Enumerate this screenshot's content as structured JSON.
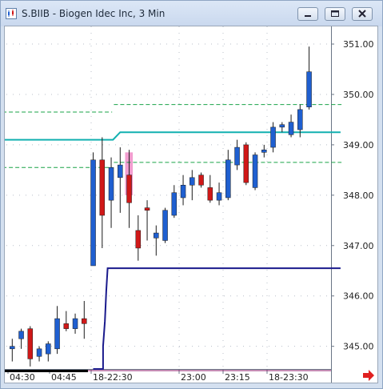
{
  "window": {
    "title": "S.BIIB - Biogen Idec Inc, 3 Min",
    "controls": [
      "minimize-icon",
      "restore-icon",
      "close-icon"
    ]
  },
  "colors": {
    "up_candle": "#1f5fd0",
    "down_candle": "#d01818",
    "teal_line": "#12b0b0",
    "green_dashed": "#19a347",
    "navy_line": "#1a1a8c",
    "highlight": "#f08cc8",
    "scroll_arrow": "#e02020"
  },
  "chart_data": {
    "type": "candlestick",
    "title": "",
    "xlabel": "",
    "ylabel": "",
    "ylim": [
      344.55,
      351.35
    ],
    "y_ticks": [
      "351.00",
      "350.00",
      "349.00",
      "348.00",
      "347.00",
      "346.00",
      "345.00"
    ],
    "x_ticks": [
      "04:30",
      "04:45",
      "18-22:30",
      "23:00",
      "23:15",
      "18-23:30"
    ],
    "grid": true,
    "candles": [
      {
        "o": 344.95,
        "h": 345.15,
        "l": 344.7,
        "c": 345.0
      },
      {
        "o": 345.15,
        "h": 345.35,
        "l": 344.95,
        "c": 345.3
      },
      {
        "o": 345.35,
        "h": 345.4,
        "l": 344.6,
        "c": 344.75
      },
      {
        "o": 344.8,
        "h": 345.0,
        "l": 344.7,
        "c": 344.95
      },
      {
        "o": 344.85,
        "h": 345.1,
        "l": 344.7,
        "c": 345.05
      },
      {
        "o": 344.95,
        "h": 345.8,
        "l": 344.85,
        "c": 345.55
      },
      {
        "o": 345.45,
        "h": 345.7,
        "l": 345.3,
        "c": 345.35
      },
      {
        "o": 345.35,
        "h": 345.65,
        "l": 345.25,
        "c": 345.55
      },
      {
        "o": 345.55,
        "h": 345.9,
        "l": 345.15,
        "c": 345.45
      },
      {
        "o": 346.6,
        "h": 348.85,
        "l": 346.6,
        "c": 348.7
      },
      {
        "o": 348.7,
        "h": 349.15,
        "l": 346.95,
        "c": 347.6
      },
      {
        "o": 347.9,
        "h": 348.75,
        "l": 347.35,
        "c": 348.55
      },
      {
        "o": 348.35,
        "h": 348.95,
        "l": 347.65,
        "c": 348.6
      },
      {
        "o": 348.4,
        "h": 348.9,
        "l": 347.35,
        "c": 347.85
      },
      {
        "o": 347.3,
        "h": 347.6,
        "l": 346.7,
        "c": 346.95
      },
      {
        "o": 347.75,
        "h": 347.9,
        "l": 347.1,
        "c": 347.7
      },
      {
        "o": 347.15,
        "h": 347.4,
        "l": 346.8,
        "c": 347.25
      },
      {
        "o": 347.1,
        "h": 347.75,
        "l": 347.05,
        "c": 347.7
      },
      {
        "o": 347.6,
        "h": 348.2,
        "l": 347.55,
        "c": 348.05
      },
      {
        "o": 347.95,
        "h": 348.4,
        "l": 347.8,
        "c": 348.2
      },
      {
        "o": 348.2,
        "h": 348.5,
        "l": 347.9,
        "c": 348.35
      },
      {
        "o": 348.4,
        "h": 348.45,
        "l": 348.15,
        "c": 348.2
      },
      {
        "o": 348.15,
        "h": 348.4,
        "l": 347.85,
        "c": 347.9
      },
      {
        "o": 347.9,
        "h": 348.25,
        "l": 347.8,
        "c": 348.05
      },
      {
        "o": 347.95,
        "h": 348.9,
        "l": 347.9,
        "c": 348.7
      },
      {
        "o": 348.6,
        "h": 349.1,
        "l": 348.5,
        "c": 348.95
      },
      {
        "o": 349.0,
        "h": 349.05,
        "l": 348.2,
        "c": 348.25
      },
      {
        "o": 348.15,
        "h": 348.85,
        "l": 348.1,
        "c": 348.8
      },
      {
        "o": 348.85,
        "h": 349.0,
        "l": 348.75,
        "c": 348.9
      },
      {
        "o": 348.95,
        "h": 349.45,
        "l": 348.85,
        "c": 349.35
      },
      {
        "o": 349.35,
        "h": 349.45,
        "l": 349.25,
        "c": 349.4
      },
      {
        "o": 349.2,
        "h": 349.6,
        "l": 349.15,
        "c": 349.45
      },
      {
        "o": 349.3,
        "h": 349.8,
        "l": 349.15,
        "c": 349.7
      },
      {
        "o": 349.75,
        "h": 350.95,
        "l": 349.7,
        "c": 350.45
      }
    ],
    "lines": [
      {
        "name": "",
        "style": "solid",
        "color": "teal",
        "points": [
          [
            -1.5,
            349.1
          ],
          [
            11.2,
            349.1
          ],
          [
            12.0,
            349.25
          ],
          [
            36.5,
            349.25
          ]
        ]
      },
      {
        "name": "",
        "style": "dashed",
        "color": "green",
        "points": [
          [
            -1.8,
            349.65
          ],
          [
            11.1,
            349.65
          ]
        ]
      },
      {
        "name": "",
        "style": "dashed",
        "color": "green",
        "points": [
          [
            -1.8,
            348.55
          ],
          [
            11.1,
            348.55
          ]
        ]
      },
      {
        "name": "",
        "style": "dashed",
        "color": "green",
        "points": [
          [
            11.3,
            349.8
          ],
          [
            36.6,
            349.8
          ]
        ]
      },
      {
        "name": "",
        "style": "dashed",
        "color": "green",
        "points": [
          [
            11.3,
            348.65
          ],
          [
            36.6,
            348.65
          ]
        ]
      },
      {
        "name": "",
        "style": "solid",
        "color": "navy",
        "points": [
          [
            9.0,
            344.55
          ],
          [
            10.1,
            344.55
          ],
          [
            10.1,
            345.0
          ],
          [
            10.3,
            345.5
          ],
          [
            10.45,
            346.1
          ],
          [
            10.6,
            346.55
          ],
          [
            36.5,
            346.55
          ]
        ]
      }
    ],
    "highlight": {
      "x_from": 12.55,
      "x_to": 13.4,
      "y_from": 348.0,
      "y_to": 348.85
    }
  }
}
